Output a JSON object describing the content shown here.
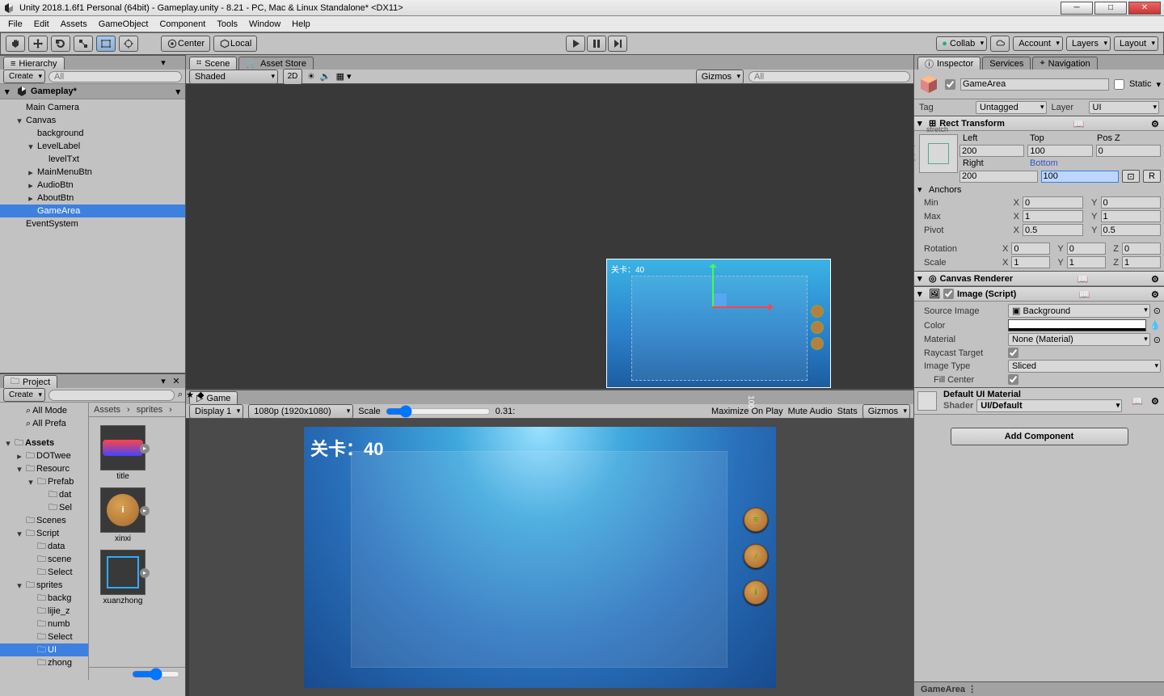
{
  "window": {
    "title": "Unity 2018.1.6f1 Personal (64bit) - Gameplay.unity - 8.21 - PC, Mac & Linux Standalone* <DX11>"
  },
  "menu": [
    "File",
    "Edit",
    "Assets",
    "GameObject",
    "Component",
    "Tools",
    "Window",
    "Help"
  ],
  "toolbar": {
    "center": "Center",
    "local": "Local",
    "collab": "Collab",
    "account": "Account",
    "layers": "Layers",
    "layout": "Layout"
  },
  "hierarchy": {
    "tab": "Hierarchy",
    "create": "Create",
    "search_placeholder": "All",
    "scene": "Gameplay*",
    "items": [
      {
        "name": "Main Camera",
        "indent": 1,
        "fold": ""
      },
      {
        "name": "Canvas",
        "indent": 1,
        "fold": "▾"
      },
      {
        "name": "background",
        "indent": 2,
        "fold": ""
      },
      {
        "name": "LevelLabel",
        "indent": 2,
        "fold": "▾"
      },
      {
        "name": "levelTxt",
        "indent": 3,
        "fold": ""
      },
      {
        "name": "MainMenuBtn",
        "indent": 2,
        "fold": "▸"
      },
      {
        "name": "AudioBtn",
        "indent": 2,
        "fold": "▸"
      },
      {
        "name": "AboutBtn",
        "indent": 2,
        "fold": "▸"
      },
      {
        "name": "GameArea",
        "indent": 2,
        "fold": "",
        "selected": true
      },
      {
        "name": "EventSystem",
        "indent": 1,
        "fold": ""
      }
    ]
  },
  "sceneview": {
    "tab_scene": "Scene",
    "tab_asset": "Asset Store",
    "shaded": "Shaded",
    "d2": "2D",
    "gizmos": "Gizmos",
    "search_placeholder": "All",
    "level_overlay": "关卡：40",
    "ruler": "100"
  },
  "gameview": {
    "tab": "Game",
    "display": "Display 1",
    "resolution": "1080p (1920x1080)",
    "scale_label": "Scale",
    "scale_value": "0.31:",
    "maximize": "Maximize On Play",
    "mute": "Mute Audio",
    "stats": "Stats",
    "gizmos": "Gizmos",
    "level_text": "关卡：40"
  },
  "project": {
    "tab": "Project",
    "create": "Create",
    "fav_all_mode": "All Mode",
    "fav_all_prefa": "All Prefa",
    "breadcrumb_assets": "Assets",
    "breadcrumb_sprites": "sprites",
    "breadcrumb_more": "›",
    "tree": [
      {
        "name": "Assets",
        "indent": 0,
        "fold": "▾",
        "bold": true
      },
      {
        "name": "DOTwee",
        "indent": 1,
        "fold": "▸"
      },
      {
        "name": "Resourc",
        "indent": 1,
        "fold": "▾"
      },
      {
        "name": "Prefab",
        "indent": 2,
        "fold": "▾"
      },
      {
        "name": "dat",
        "indent": 3,
        "fold": ""
      },
      {
        "name": "Sel",
        "indent": 3,
        "fold": ""
      },
      {
        "name": "Scenes",
        "indent": 1,
        "fold": ""
      },
      {
        "name": "Script",
        "indent": 1,
        "fold": "▾"
      },
      {
        "name": "data",
        "indent": 2,
        "fold": ""
      },
      {
        "name": "scene",
        "indent": 2,
        "fold": ""
      },
      {
        "name": "Select",
        "indent": 2,
        "fold": ""
      },
      {
        "name": "sprites",
        "indent": 1,
        "fold": "▾"
      },
      {
        "name": "backg",
        "indent": 2,
        "fold": ""
      },
      {
        "name": "lijie_z",
        "indent": 2,
        "fold": ""
      },
      {
        "name": "numb",
        "indent": 2,
        "fold": ""
      },
      {
        "name": "Select",
        "indent": 2,
        "fold": ""
      },
      {
        "name": "UI",
        "indent": 2,
        "fold": "",
        "selected": true
      },
      {
        "name": "zhong",
        "indent": 2,
        "fold": ""
      }
    ],
    "grid": [
      {
        "label": "title"
      },
      {
        "label": "xinxi"
      },
      {
        "label": "xuanzhong",
        "sel": true
      }
    ]
  },
  "inspector": {
    "tab": "Inspector",
    "tab2": "Services",
    "tab3": "Navigation",
    "name": "GameArea",
    "static": "Static",
    "tag_label": "Tag",
    "tag": "Untagged",
    "layer_label": "Layer",
    "layer": "UI",
    "rect_transform": {
      "title": "Rect Transform",
      "cols": [
        "Left",
        "Top",
        "Pos Z"
      ],
      "row1": [
        "200",
        "100",
        "0"
      ],
      "cols2": [
        "Right",
        "Bottom"
      ],
      "row2": [
        "200",
        "100"
      ],
      "anchors": "Anchors",
      "min": "Min",
      "min_x": "0",
      "min_y": "0",
      "max": "Max",
      "max_x": "1",
      "max_y": "1",
      "pivot": "Pivot",
      "pivot_x": "0.5",
      "pivot_y": "0.5",
      "rotation": "Rotation",
      "rot_x": "0",
      "rot_y": "0",
      "rot_z": "0",
      "scale": "Scale",
      "scale_x": "1",
      "scale_y": "1",
      "scale_z": "1",
      "stretch": "stretch"
    },
    "canvas_renderer": {
      "title": "Canvas Renderer"
    },
    "image": {
      "title": "Image (Script)",
      "source": "Source Image",
      "source_val": "Background",
      "color": "Color",
      "color_val": "#ffffff",
      "material": "Material",
      "material_val": "None (Material)",
      "raycast": "Raycast Target",
      "image_type": "Image Type",
      "image_type_val": "Sliced",
      "fill_center": "Fill Center"
    },
    "default_mat": {
      "title": "Default UI Material",
      "shader_label": "Shader",
      "shader": "UI/Default"
    },
    "add_component": "Add Component"
  },
  "footer": "GameArea"
}
